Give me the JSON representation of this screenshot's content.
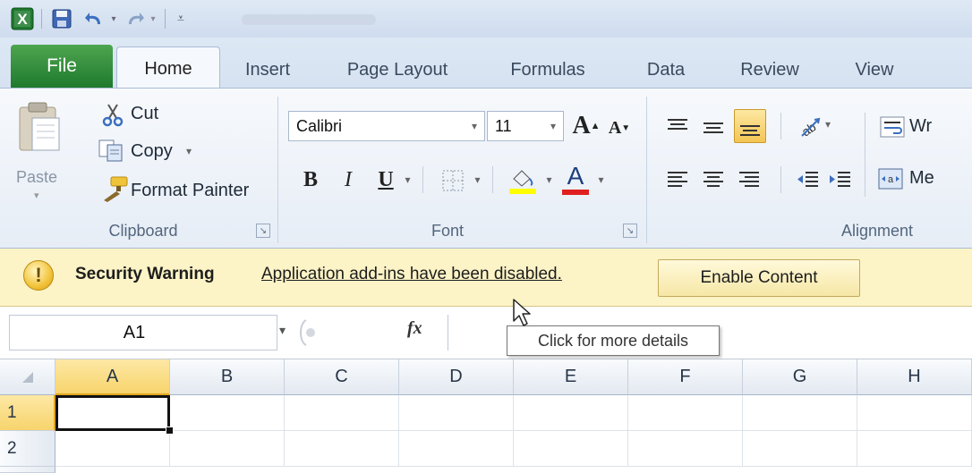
{
  "ribbon_tabs": [
    {
      "label": "File"
    },
    {
      "label": "Home"
    },
    {
      "label": "Insert"
    },
    {
      "label": "Page Layout"
    },
    {
      "label": "Formulas"
    },
    {
      "label": "Data"
    },
    {
      "label": "Review"
    },
    {
      "label": "View"
    }
  ],
  "clipboard": {
    "paste_label": "Paste",
    "cut_label": "Cut",
    "copy_label": "Copy",
    "format_painter_label": "Format Painter",
    "group_label": "Clipboard"
  },
  "font": {
    "font_name": "Calibri",
    "font_size": "11",
    "grow_label": "A",
    "shrink_label": "A",
    "bold_label": "B",
    "italic_label": "I",
    "underline_label": "U",
    "font_color_label": "A",
    "group_label": "Font"
  },
  "alignment": {
    "wrap_text_label": "Wr",
    "merge_label": "Me",
    "group_label": "Alignment"
  },
  "security_bar": {
    "title": "Security Warning",
    "message": "Application add-ins have been disabled.",
    "button_label": "Enable Content"
  },
  "formula_bar": {
    "name_box": "A1",
    "fx_label": "fx",
    "formula": ""
  },
  "tooltip": {
    "text": "Click for more details"
  },
  "grid": {
    "columns": [
      "A",
      "B",
      "C",
      "D",
      "E",
      "F",
      "G",
      "H"
    ],
    "rows": [
      "1",
      "2"
    ],
    "selected_cell": "A1"
  },
  "colors": {
    "file_tab": "#1f7a2e",
    "security_bar_bg": "#fcf3c6",
    "selection_header": "#f7d46c",
    "underline_red": "#e02020",
    "fill_yellow": "#ffff00"
  }
}
